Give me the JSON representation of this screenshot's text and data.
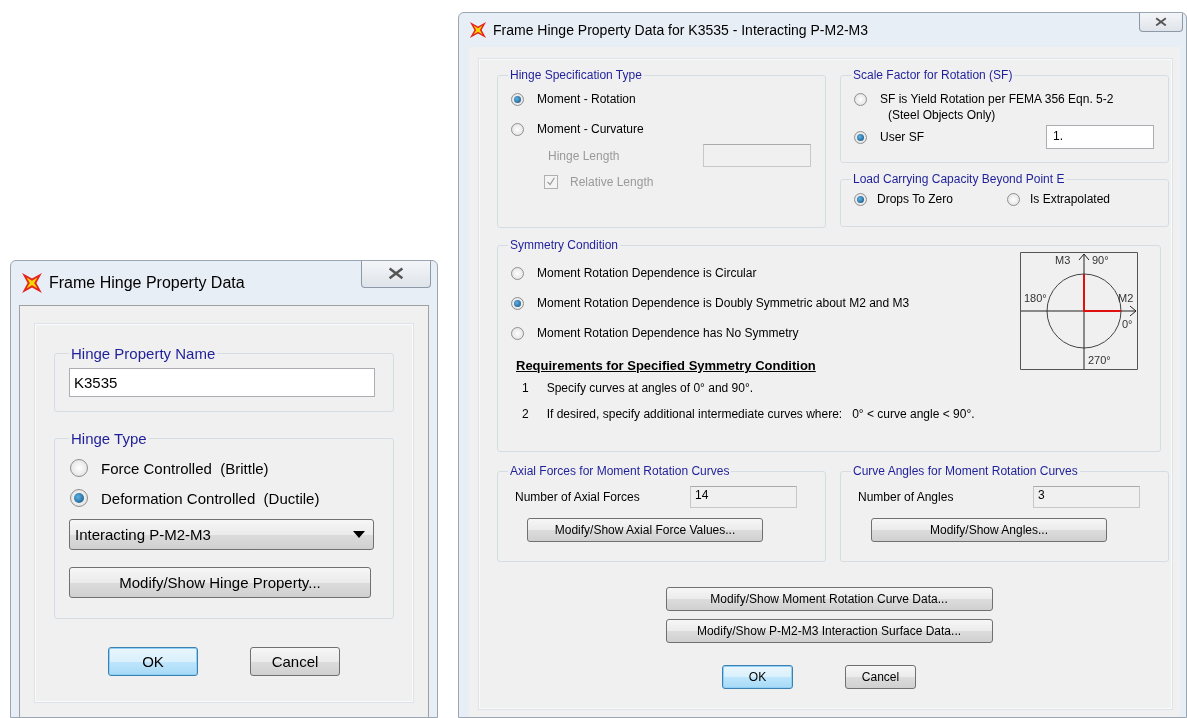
{
  "name_dialog": {
    "title": "Frame Hinge Property Data",
    "name_group": {
      "label": "Hinge Property Name",
      "value": "K3535"
    },
    "type_group": {
      "label": "Hinge Type",
      "options": [
        {
          "label": "Force Controlled  (Brittle)",
          "selected": false
        },
        {
          "label": "Deformation Controlled  (Ductile)",
          "selected": true
        }
      ],
      "dropdown": "Interacting P-M2-M3",
      "button": "Modify/Show Hinge Property..."
    },
    "buttons": [
      {
        "label": "OK",
        "default": true
      },
      {
        "label": "Cancel",
        "default": false
      }
    ]
  },
  "data_dialog": {
    "title": "Frame Hinge Property Data for K3535 - Interacting P-M2-M3",
    "spec_type": {
      "label": "Hinge Specification Type",
      "options": [
        {
          "label": "Moment - Rotation",
          "selected": true
        },
        {
          "label": "Moment - Curvature",
          "selected": false
        }
      ],
      "hinge_length": {
        "label": "Hinge Length",
        "disabled": true
      },
      "relative_length": {
        "label": "Relative Length",
        "checked": true,
        "disabled": true
      }
    },
    "scale_factor": {
      "label": "Scale Factor for Rotation (SF)",
      "options": [
        {
          "label": "SF is Yield Rotation per FEMA 356 Eqn. 5-2",
          "note": "(Steel Objects Only)",
          "selected": false
        },
        {
          "label": "User SF",
          "value": "1.",
          "selected": true
        }
      ]
    },
    "capacity": {
      "label": "Load Carrying Capacity Beyond Point E",
      "options": [
        {
          "label": "Drops To Zero",
          "selected": true
        },
        {
          "label": "Is Extrapolated",
          "selected": false
        }
      ]
    },
    "symmetry": {
      "label": "Symmetry Condition",
      "options": [
        {
          "label": "Moment Rotation Dependence is Circular",
          "selected": false
        },
        {
          "label": "Moment Rotation Dependence is Doubly Symmetric about M2 and M3",
          "selected": true
        },
        {
          "label": "Moment Rotation Dependence has No Symmetry",
          "selected": false
        }
      ],
      "requirements_title": "Requirements for Specified Symmetry Condition",
      "requirements": [
        {
          "number": "1",
          "text": "Specify curves at angles of 0° and 90°."
        },
        {
          "number": "2",
          "text": "If desired, specify additional intermediate curves where:   0° < curve angle < 90°."
        }
      ],
      "diagram": {
        "vertical_axis": "M3",
        "top_angle": "90°",
        "left_angle": "180°",
        "horizontal_axis": "M2",
        "right_angle": "0°",
        "bottom_angle": "270°"
      }
    },
    "axial": {
      "label": "Axial Forces for Moment Rotation Curves",
      "field_label": "Number of Axial Forces",
      "value": "14",
      "button": "Modify/Show Axial Force Values..."
    },
    "angles": {
      "label": "Curve Angles for Moment Rotation Curves",
      "field_label": "Number of Angles",
      "value": "3",
      "button": "Modify/Show Angles..."
    },
    "data_buttons": [
      "Modify/Show Moment Rotation Curve Data...",
      "Modify/Show P-M2-M3 Interaction Surface Data..."
    ],
    "buttons": [
      {
        "label": "OK",
        "default": true
      },
      {
        "label": "Cancel",
        "default": false
      }
    ]
  }
}
